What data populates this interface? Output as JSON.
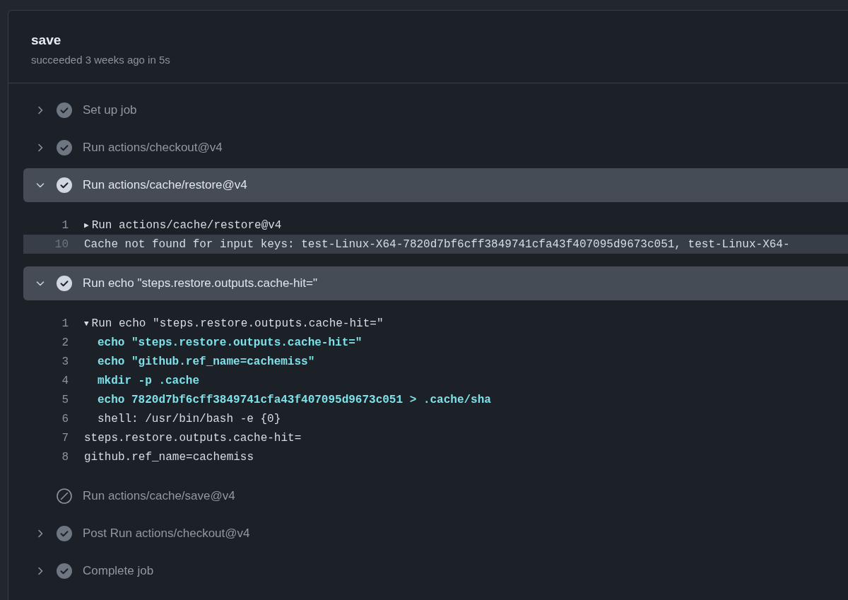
{
  "job": {
    "title": "save",
    "summary": "succeeded 3 weeks ago in 5s"
  },
  "steps": [
    {
      "label": "Set up job",
      "kind": "success",
      "expandable": true,
      "expanded": false
    },
    {
      "label": "Run actions/checkout@v4",
      "kind": "success",
      "expandable": true,
      "expanded": false
    },
    {
      "label": "Run actions/cache/restore@v4",
      "kind": "success",
      "expandable": true,
      "expanded": true,
      "log": [
        {
          "number": "1",
          "kind": "group",
          "marker": "▶",
          "text": "Run actions/cache/restore@v4",
          "selected": false
        },
        {
          "number": "10",
          "kind": "output",
          "text": "Cache not found for input keys: test-Linux-X64-7820d7bf6cff3849741cfa43f407095d9673c051, test-Linux-X64-",
          "selected": true
        }
      ]
    },
    {
      "label": "Run echo \"steps.restore.outputs.cache-hit=\"",
      "kind": "success",
      "expandable": true,
      "expanded": true,
      "log": [
        {
          "number": "1",
          "kind": "group",
          "marker": "▼",
          "text": "Run echo \"steps.restore.outputs.cache-hit=\"",
          "selected": false
        },
        {
          "number": "2",
          "kind": "command",
          "text": "echo \"steps.restore.outputs.cache-hit=\"",
          "selected": false
        },
        {
          "number": "3",
          "kind": "command",
          "text": "echo \"github.ref_name=cachemiss\"",
          "selected": false
        },
        {
          "number": "4",
          "kind": "command",
          "text": "mkdir -p .cache",
          "selected": false
        },
        {
          "number": "5",
          "kind": "command",
          "text": "echo 7820d7bf6cff3849741cfa43f407095d9673c051 > .cache/sha",
          "selected": false
        },
        {
          "number": "6",
          "kind": "detail",
          "text": "shell: /usr/bin/bash -e {0}",
          "selected": false
        },
        {
          "number": "7",
          "kind": "output",
          "text": "steps.restore.outputs.cache-hit=",
          "selected": false
        },
        {
          "number": "8",
          "kind": "output",
          "text": "github.ref_name=cachemiss",
          "selected": false
        }
      ]
    },
    {
      "label": "Run actions/cache/save@v4",
      "kind": "skipped",
      "expandable": false,
      "expanded": false
    },
    {
      "label": "Post Run actions/checkout@v4",
      "kind": "success",
      "expandable": true,
      "expanded": false
    },
    {
      "label": "Complete job",
      "kind": "success",
      "expandable": true,
      "expanded": false
    }
  ]
}
